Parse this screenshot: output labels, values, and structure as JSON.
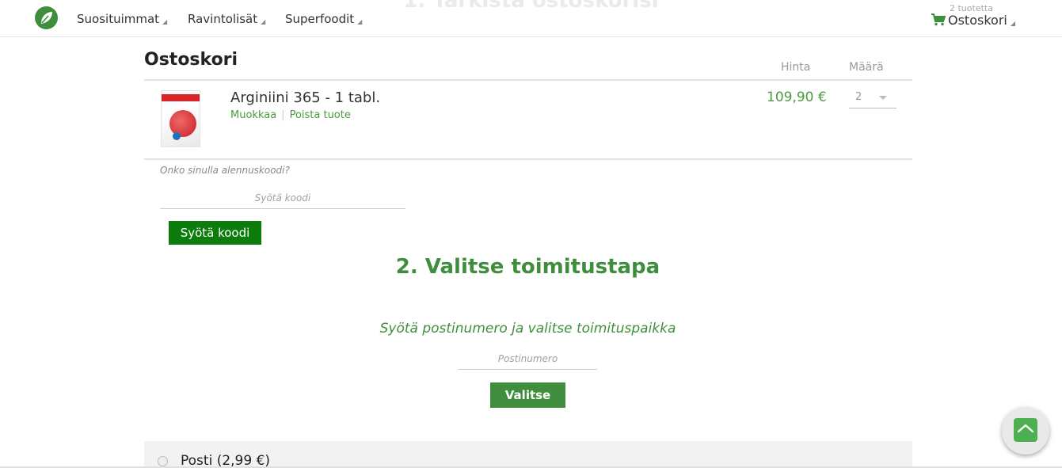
{
  "ghost_heading": "1. Tarkista ostoskorisi",
  "header": {
    "nav": [
      {
        "label": "Suosituimmat"
      },
      {
        "label": "Ravintolisät"
      },
      {
        "label": "Superfoodit"
      }
    ],
    "cart_count": "2 tuotetta",
    "cart_label": "Ostoskori"
  },
  "cart": {
    "title": "Ostoskori",
    "col_price": "Hinta",
    "col_qty": "Määrä",
    "item": {
      "name": "Arginiini 365 - 1 tabl.",
      "edit_label": "Muokkaa",
      "remove_label": "Poista tuote",
      "price": "109,90 €",
      "qty": "2"
    },
    "coupon_question": "Onko sinulla alennuskoodi?",
    "coupon_placeholder": "Syötä koodi",
    "coupon_button": "Syötä koodi"
  },
  "shipping": {
    "title": "2. Valitse toimitustapa",
    "subtitle": "Syötä postinumero ja valitse toimituspaikka",
    "postal_placeholder": "Postinumero",
    "postal_button": "Valitse",
    "options": [
      {
        "label": "Posti (2,99 €)"
      }
    ]
  },
  "colors": {
    "brand_green": "#3e8e3e",
    "price_green": "#4c9a3f",
    "coupon_button": "#0c7d0c"
  },
  "icons": [
    "leaf-logo-icon",
    "cart-icon",
    "chevron-up-icon"
  ]
}
